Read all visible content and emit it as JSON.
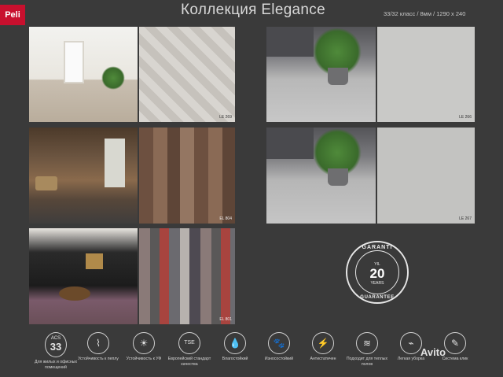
{
  "brand": {
    "logo_text": "Peli"
  },
  "header": {
    "title": "Коллекция Elegance",
    "spec": "33/32 класс / 8мм / 1290 x 240"
  },
  "swatches": [
    {
      "code": "LE 269"
    },
    {
      "code": "EL 804"
    },
    {
      "code": "EL 801"
    },
    {
      "code": "LE 266"
    },
    {
      "code": "LE 267"
    }
  ],
  "seal": {
    "top": "GARANTI",
    "yil": "YIL",
    "number": "20",
    "years": "YEARS",
    "bottom": "GUARANTEE"
  },
  "features": {
    "acs": {
      "label_top": "ACS",
      "number": "33",
      "text": "Для жилых и офисных помещений"
    },
    "items": [
      {
        "icon": "cigarette-icon",
        "glyph": "⌇",
        "text": "Устойчивость к пеплу"
      },
      {
        "icon": "sun-icon",
        "glyph": "☀",
        "text": "Устойчивость к УФ"
      },
      {
        "icon": "tse-icon",
        "glyph": "TSE",
        "text": "Европейский стандарт качества"
      },
      {
        "icon": "water-drop-icon",
        "glyph": "💧",
        "text": "Влагостойкий"
      },
      {
        "icon": "paw-icon",
        "glyph": "🐾",
        "text": "Износостойкий"
      },
      {
        "icon": "lightning-icon",
        "glyph": "⚡",
        "text": "Антистатичен"
      },
      {
        "icon": "heating-icon",
        "glyph": "≋",
        "text": "Подходит для теплых полов"
      },
      {
        "icon": "mop-icon",
        "glyph": "⌁",
        "text": "Легкая уборка"
      },
      {
        "icon": "pencil-icon",
        "glyph": "✎",
        "text": "Система клик"
      }
    ]
  },
  "watermark": "Avito"
}
